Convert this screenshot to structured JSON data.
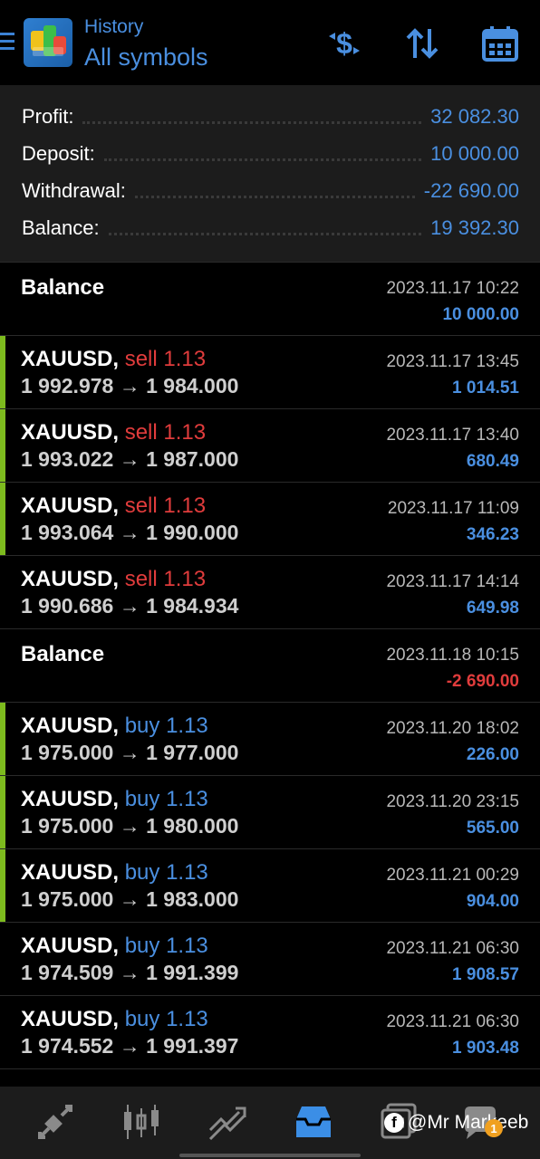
{
  "header": {
    "title_small": "History",
    "title_big": "All symbols",
    "icons": [
      "menu-icon",
      "metatrader-logo",
      "currency-filter-icon",
      "sort-icon",
      "calendar-icon"
    ]
  },
  "summary": {
    "profit_label": "Profit:",
    "profit_value": "32 082.30",
    "deposit_label": "Deposit:",
    "deposit_value": "10 000.00",
    "withdrawal_label": "Withdrawal:",
    "withdrawal_value": "-22 690.00",
    "balance_label": "Balance:",
    "balance_value": "19 392.30"
  },
  "rows": [
    {
      "kind": "balance",
      "title": "Balance",
      "time": "2023.11.17 10:22",
      "amount": "10 000.00",
      "sign": "pos"
    },
    {
      "kind": "trade",
      "symbol": "XAUUSD,",
      "type": "sell",
      "volume": "1.13",
      "open": "1 992.978",
      "close": "1 984.000",
      "time": "2023.11.17 13:45",
      "amount": "1 014.51",
      "sign": "pos",
      "bar": true
    },
    {
      "kind": "trade",
      "symbol": "XAUUSD,",
      "type": "sell",
      "volume": "1.13",
      "open": "1 993.022",
      "close": "1 987.000",
      "time": "2023.11.17 13:40",
      "amount": "680.49",
      "sign": "pos",
      "bar": true
    },
    {
      "kind": "trade",
      "symbol": "XAUUSD,",
      "type": "sell",
      "volume": "1.13",
      "open": "1 993.064",
      "close": "1 990.000",
      "time": "2023.11.17 11:09",
      "amount": "346.23",
      "sign": "pos",
      "bar": true
    },
    {
      "kind": "trade",
      "symbol": "XAUUSD,",
      "type": "sell",
      "volume": "1.13",
      "open": "1 990.686",
      "close": "1 984.934",
      "time": "2023.11.17 14:14",
      "amount": "649.98",
      "sign": "pos",
      "bar": false
    },
    {
      "kind": "balance",
      "title": "Balance",
      "time": "2023.11.18 10:15",
      "amount": "-2 690.00",
      "sign": "neg"
    },
    {
      "kind": "trade",
      "symbol": "XAUUSD,",
      "type": "buy",
      "volume": "1.13",
      "open": "1 975.000",
      "close": "1 977.000",
      "time": "2023.11.20 18:02",
      "amount": "226.00",
      "sign": "pos",
      "bar": true
    },
    {
      "kind": "trade",
      "symbol": "XAUUSD,",
      "type": "buy",
      "volume": "1.13",
      "open": "1 975.000",
      "close": "1 980.000",
      "time": "2023.11.20 23:15",
      "amount": "565.00",
      "sign": "pos",
      "bar": true
    },
    {
      "kind": "trade",
      "symbol": "XAUUSD,",
      "type": "buy",
      "volume": "1.13",
      "open": "1 975.000",
      "close": "1 983.000",
      "time": "2023.11.21 00:29",
      "amount": "904.00",
      "sign": "pos",
      "bar": true
    },
    {
      "kind": "trade",
      "symbol": "XAUUSD,",
      "type": "buy",
      "volume": "1.13",
      "open": "1 974.509",
      "close": "1 991.399",
      "time": "2023.11.21 06:30",
      "amount": "1 908.57",
      "sign": "pos",
      "bar": false
    },
    {
      "kind": "trade",
      "symbol": "XAUUSD,",
      "type": "buy",
      "volume": "1.13",
      "open": "1 974.552",
      "close": "1 991.397",
      "time": "2023.11.21 06:30",
      "amount": "1 903.48",
      "sign": "pos",
      "bar": false
    }
  ],
  "arrow": "→",
  "bottom_nav": {
    "items": [
      "quotes-icon",
      "chart-icon",
      "trade-icon",
      "history-icon",
      "messages-icon",
      "chat-icon"
    ],
    "active": "history-icon"
  },
  "watermark": {
    "fb_letter": "f",
    "text": "@Mr Markeeb",
    "badge": "1"
  },
  "colors": {
    "accent": "#4a8fe0",
    "sell": "#e03c3c",
    "buy": "#4a8fe0",
    "profit_bar": "#7dbb1e",
    "panel": "#1c1c1c"
  }
}
